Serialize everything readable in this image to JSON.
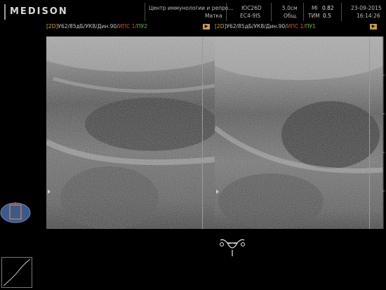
{
  "brand": {
    "logo_text": "MEDISON"
  },
  "header": {
    "institution": "Центр иммунологии и репро...",
    "study": "Матка",
    "probe_model": "ЮС26D",
    "transducer": "EC4-9IS",
    "depth": "5.0см",
    "preset": "Общ.",
    "mi_label": "MI",
    "mi_value": "0.82",
    "tim_label": "ТИМ",
    "tim_value": "0.5",
    "date": "23-09-2015",
    "time": "16:14:26"
  },
  "left_image": {
    "mode": "[2D]",
    "params": "У62/85дБ/УК8/Дин.90/",
    "ips": "ИПС 1/",
    "pu": "ПУ2",
    "badge": "▶"
  },
  "right_image": {
    "mode": "[2D]",
    "params": "У62/85дБ/УК8/Дин.90/",
    "ips": "ИПС 1/",
    "pu": "ПУ1",
    "badge": "▶"
  },
  "colors": {
    "mode_tag": "#d8a93a",
    "ips_tag": "#e04a2a",
    "pu_tag": "#56c23a",
    "badge": "#c9a030",
    "probe_icon": "#3a5a8a"
  },
  "icons": {
    "probe_orientation": "transvaginal-probe-icon",
    "gray_map": "gray-curve-icon",
    "body_marker": "uterus-bodymark-icon"
  }
}
